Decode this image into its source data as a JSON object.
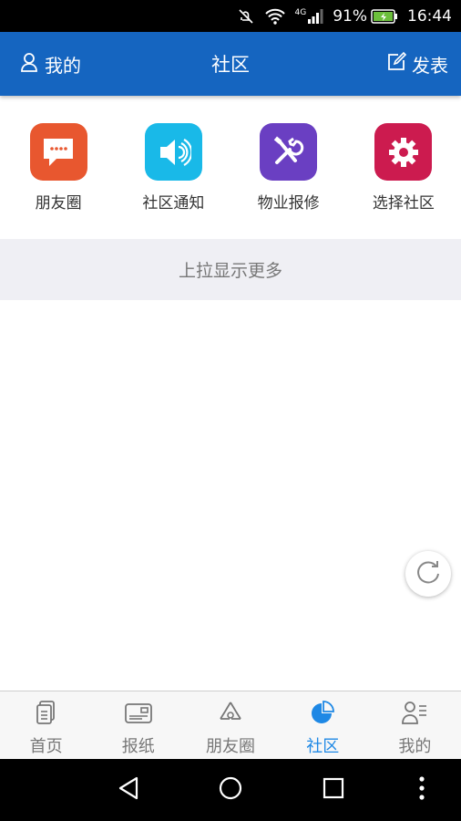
{
  "status_bar": {
    "network": "4G",
    "battery": "91%",
    "time": "16:44"
  },
  "header": {
    "left_label": "我的",
    "title": "社区",
    "right_label": "发表",
    "color": "#1565c0"
  },
  "quick_actions": [
    {
      "label": "朋友圈",
      "icon": "chat-bubble-icon",
      "color": "#e8572f"
    },
    {
      "label": "社区通知",
      "icon": "speaker-icon",
      "color": "#19b9e8"
    },
    {
      "label": "物业报修",
      "icon": "tools-icon",
      "color": "#6a3fc2"
    },
    {
      "label": "选择社区",
      "icon": "gear-icon",
      "color": "#cc1b4f"
    }
  ],
  "pull_more": "上拉显示更多",
  "tabs": [
    {
      "label": "首页",
      "icon": "document-icon",
      "active": false
    },
    {
      "label": "报纸",
      "icon": "newspaper-icon",
      "active": false
    },
    {
      "label": "朋友圈",
      "icon": "recycle-icon",
      "active": false
    },
    {
      "label": "社区",
      "icon": "pie-chart-icon",
      "active": true
    },
    {
      "label": "我的",
      "icon": "user-list-icon",
      "active": false
    }
  ],
  "accent_color": "#1e88e5"
}
